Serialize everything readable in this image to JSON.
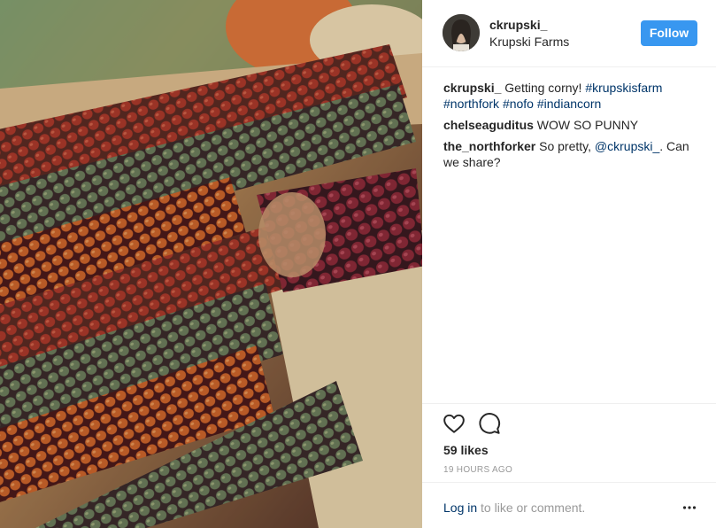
{
  "header": {
    "username": "ckrupski_",
    "location": "Krupski Farms",
    "follow_label": "Follow"
  },
  "comments": [
    {
      "user": "ckrupski_",
      "text": " Getting corny! ",
      "tags": [
        "#krupskisfarm",
        "#northfork",
        "#nofo",
        "#indiancorn"
      ]
    },
    {
      "user": "chelseaguditus",
      "text": " WOW SO PUNNY"
    },
    {
      "user": "the_northforker",
      "text": " So pretty, ",
      "mention": "@ckrupski_",
      "text_after": ". Can we share?"
    }
  ],
  "actions": {
    "like_icon": "heart-icon",
    "comment_icon": "speech-bubble-icon",
    "likes": "59 likes",
    "time": "19 HOURS AGO"
  },
  "footer": {
    "login_link": "Log in",
    "login_rest": " to like or comment.",
    "more_icon": "ellipsis-icon"
  },
  "colors": {
    "accent": "#3897f0",
    "link": "#003569",
    "muted": "#999999"
  }
}
